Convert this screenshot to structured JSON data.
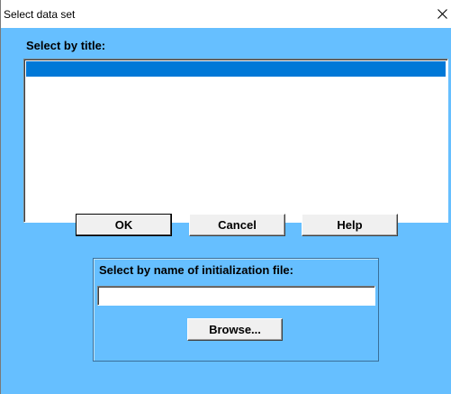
{
  "window": {
    "title": "Select data set",
    "close_icon": "close-icon"
  },
  "list": {
    "label": "Select by title:",
    "items": [
      ""
    ],
    "selected_index": 0
  },
  "buttons": {
    "ok": "OK",
    "cancel": "Cancel",
    "help": "Help",
    "browse": "Browse..."
  },
  "file_group": {
    "label": "Select by name of initialization file:",
    "value": "",
    "placeholder": ""
  },
  "colors": {
    "background": "#66bfff",
    "selection": "#0078d7"
  }
}
